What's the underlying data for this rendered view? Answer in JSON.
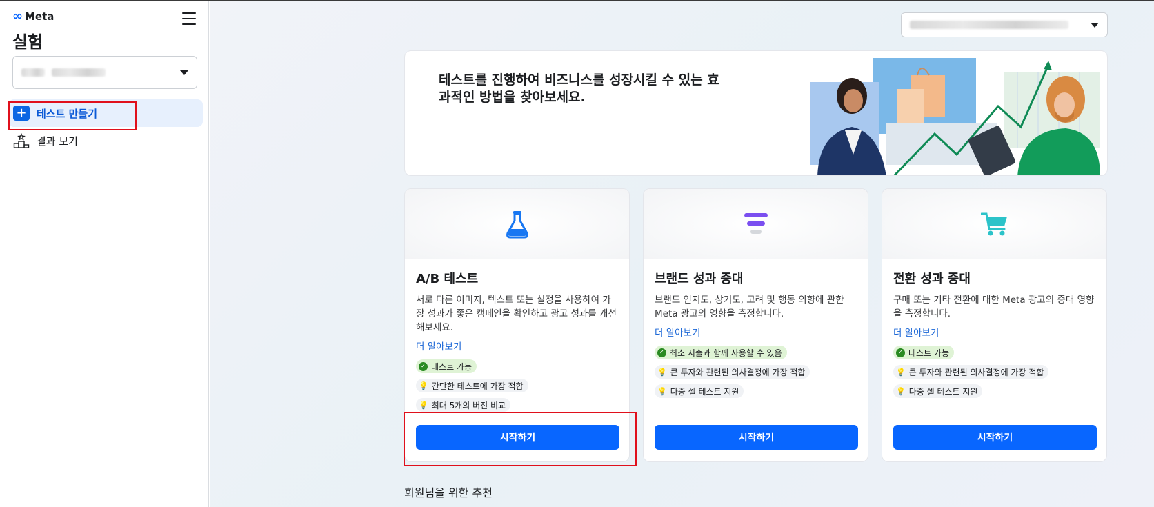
{
  "sidebar": {
    "brand": "Meta",
    "title": "실험",
    "nav": [
      {
        "label": "테스트 만들기",
        "icon": "plus-icon",
        "active": true
      },
      {
        "label": "결과 보기",
        "icon": "results-icon",
        "active": false
      }
    ]
  },
  "hero": {
    "headline": "테스트를 진행하여 비즈니스를 성장시킬 수 있는 효과적인 방법을 찾아보세요."
  },
  "cards": [
    {
      "title": "A/B 테스트",
      "icon": "flask-icon",
      "description": "서로 다른 이미지, 텍스트 또는 설정을 사용하여 가장 성과가 좋은 캠페인을 확인하고 광고 성과를 개선해보세요.",
      "learn_more": "더 알아보기",
      "tags": [
        "테스트 가능",
        "간단한 테스트에 가장 적합",
        "최대 5개의 버전 비교"
      ],
      "button": "시작하기"
    },
    {
      "title": "브랜드 성과 증대",
      "icon": "funnel-icon",
      "description": "브랜드 인지도, 상기도, 고려 및 행동 의향에 관한 Meta 광고의 영향을 측정합니다.",
      "learn_more": "더 알아보기",
      "tags": [
        "최소 지출과 함께 사용할 수 있음",
        "큰 투자와 관련된 의사결정에 가장 적합",
        "다중 셀 테스트 지원"
      ],
      "button": "시작하기"
    },
    {
      "title": "전환 성과 증대",
      "icon": "cart-icon",
      "description": "구매 또는 기타 전환에 대한 Meta 광고의 증대 영향을 측정합니다.",
      "learn_more": "더 알아보기",
      "tags": [
        "테스트 가능",
        "큰 투자와 관련된 의사결정에 가장 적합",
        "다중 셀 테스트 지원"
      ],
      "button": "시작하기"
    }
  ],
  "section": {
    "recommendations": "회원님을 위한 추천"
  },
  "colors": {
    "primary": "#0866ff",
    "highlight_box": "#e0101c",
    "tag_green": "#dff3d5",
    "flask": "#1877f2",
    "funnel": "#7b4ff0",
    "cart": "#2cc3c9"
  }
}
